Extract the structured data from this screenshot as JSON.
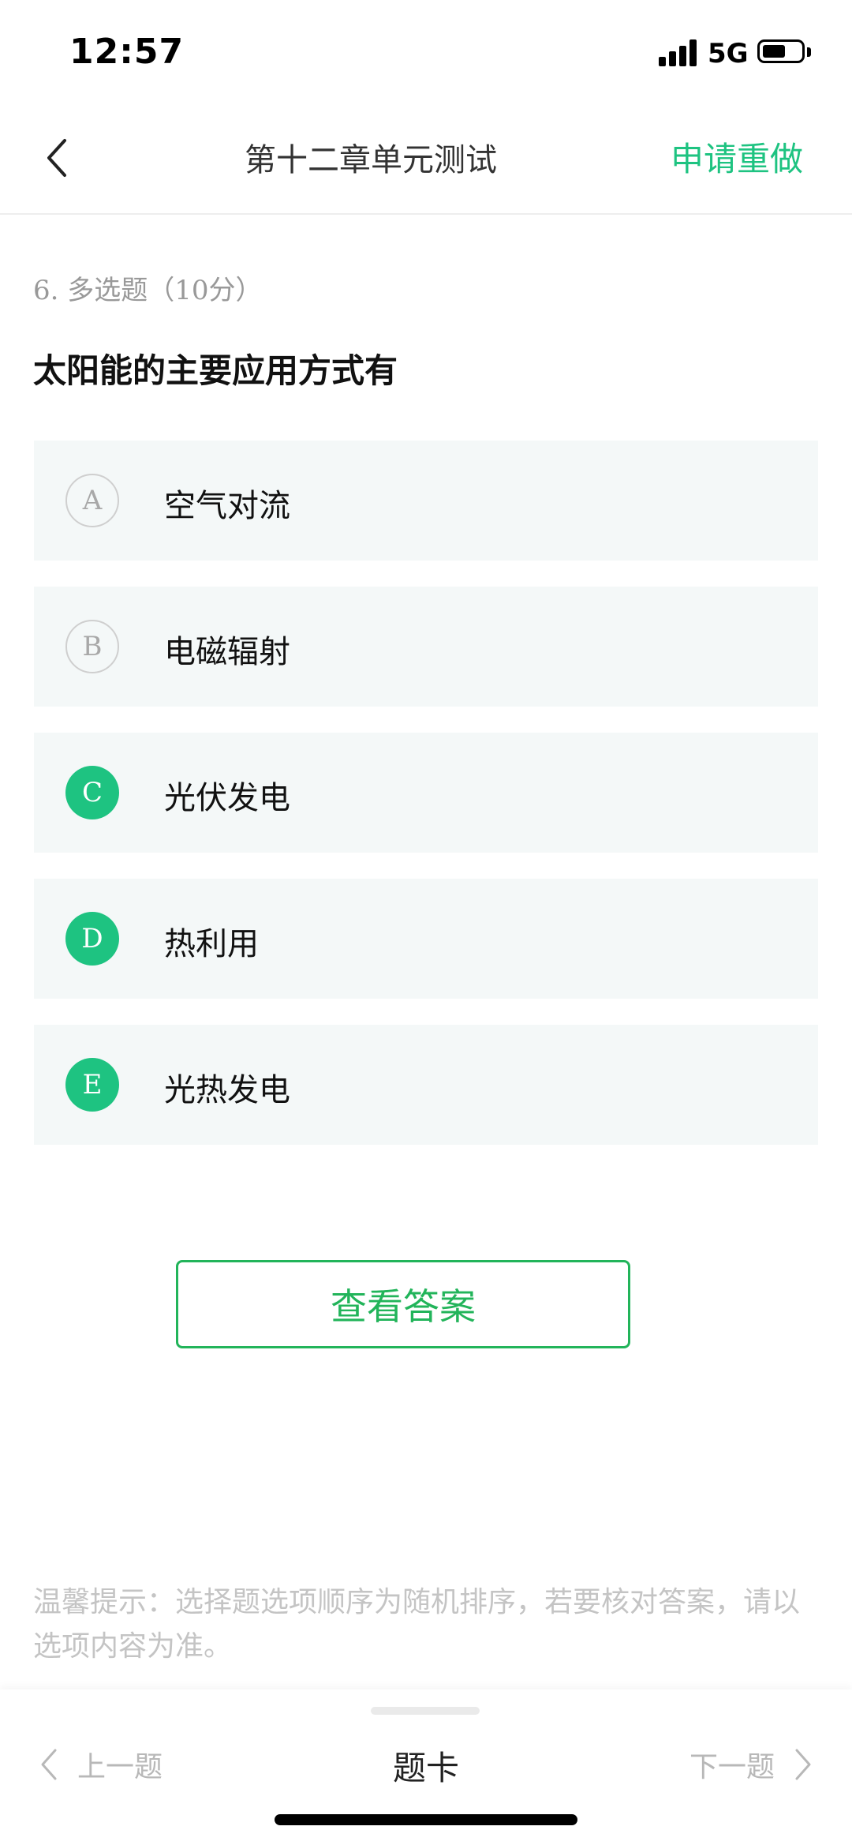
{
  "status_bar": {
    "time": "12:57",
    "network": "5G",
    "battery_level": 0.6,
    "icons": [
      "signal-icon",
      "battery-icon"
    ]
  },
  "header": {
    "title": "第十二章单元测试",
    "redo_label": "申请重做",
    "back_icon": "chevron-left-icon"
  },
  "question": {
    "meta": "6. 多选题（10分）",
    "stem": "太阳能的主要应用方式有",
    "options": [
      {
        "letter": "A",
        "text": "空气对流",
        "selected": false
      },
      {
        "letter": "B",
        "text": "电磁辐射",
        "selected": false
      },
      {
        "letter": "C",
        "text": "光伏发电",
        "selected": true
      },
      {
        "letter": "D",
        "text": "热利用",
        "selected": true
      },
      {
        "letter": "E",
        "text": "光热发电",
        "selected": true
      }
    ]
  },
  "answer_button": "查看答案",
  "tip": "温馨提示：选择题选项顺序为随机排序，若要核对答案，请以选项内容为准。",
  "bottom_nav": {
    "prev_label": "上一题",
    "card_label": "题卡",
    "next_label": "下一题"
  },
  "colors": {
    "accent": "#1ec381",
    "button_green": "#22b45a",
    "option_bg": "#f4f8f8",
    "muted_text": "#999999"
  }
}
